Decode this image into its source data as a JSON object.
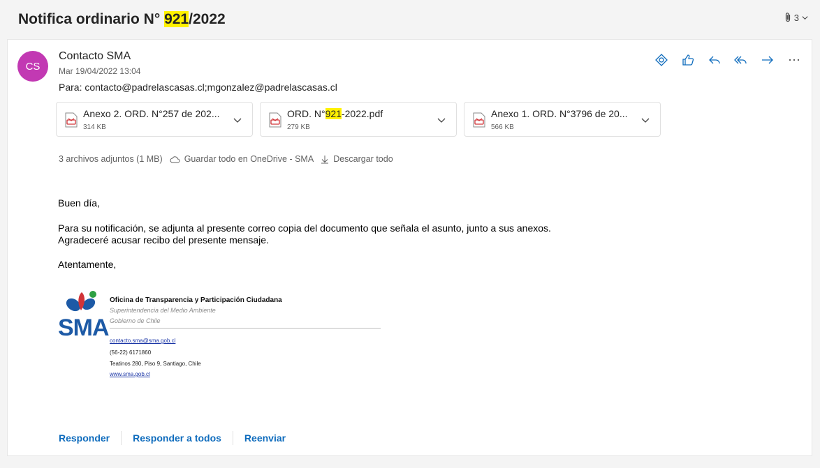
{
  "subject": {
    "prefix": "Notifica ordinario N° ",
    "highlight": "921",
    "suffix": "/2022"
  },
  "attachment_count": "3",
  "message": {
    "avatar_initials": "CS",
    "avatar_color": "#c239b3",
    "sender": "Contacto SMA",
    "date": "Mar 19/04/2022 13:04",
    "to": "Para: contacto@padrelascasas.cl;mgonzalez@padrelascasas.cl"
  },
  "actions": {
    "icons": [
      "sticker-icon",
      "like-icon",
      "reply-icon",
      "reply-all-icon",
      "forward-icon",
      "more-icon"
    ]
  },
  "attachments": [
    {
      "name": "Anexo 2. ORD. N°257 de 202...",
      "size": "314 KB"
    },
    {
      "name_prefix": "ORD. N°",
      "name_highlight": "921",
      "name_suffix": "-2022.pdf",
      "size": "279 KB"
    },
    {
      "name": "Anexo 1. ORD. N°3796 de 20...",
      "size": "566 KB"
    }
  ],
  "attachment_summary": {
    "count_text": "3 archivos adjuntos (1 MB)",
    "save_onedrive": "Guardar todo en OneDrive - SMA",
    "download_all": "Descargar todo"
  },
  "body": {
    "greeting": "Buen día,",
    "line1": "Para su notificación, se adjunta al presente correo copia del documento que señala el asunto, junto a sus anexos.",
    "line2": "Agradeceré acusar recibo del presente mensaje.",
    "closing": "Atentamente,"
  },
  "signature": {
    "org": "Oficina de Transparencia y Participación Ciudadana",
    "sub1": "Superintendencia del Medio Ambiente",
    "sub2": "Gobierno de Chile",
    "logo_text": "SMA",
    "email": "contacto.sma@sma.gob.cl",
    "phone": "(56-22) 6171860",
    "address": "Teatinos 280, Piso 9, Santiago, Chile",
    "web": "www.sma.gob.cl"
  },
  "replies": {
    "reply": "Responder",
    "reply_all": "Responder a todos",
    "forward": "Reenviar"
  },
  "colors": {
    "accent": "#0f6cbd",
    "highlight": "#fff100",
    "pdf_red": "#d13438"
  }
}
